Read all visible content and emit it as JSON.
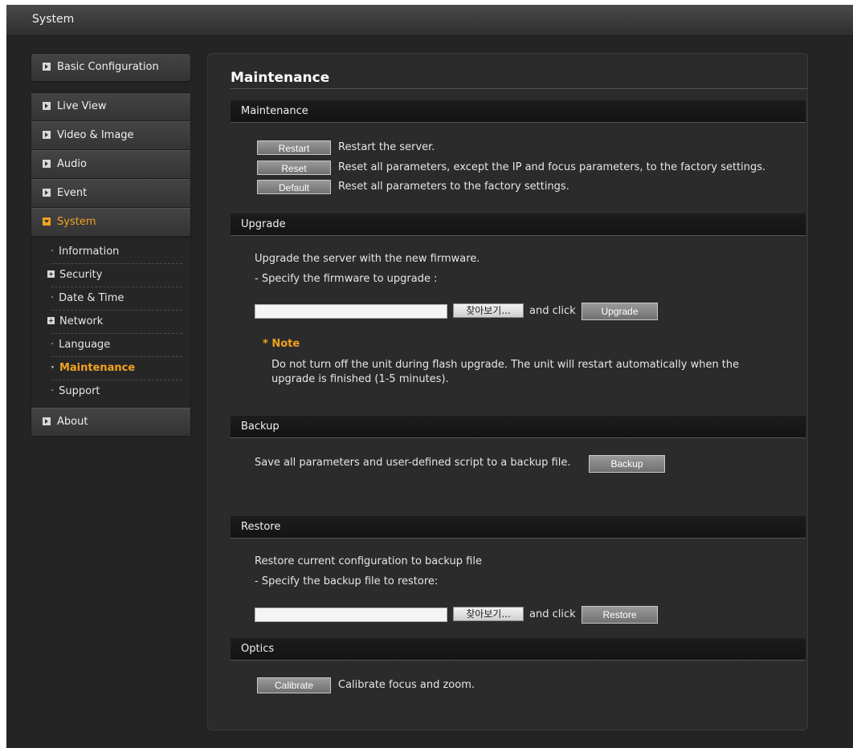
{
  "window": {
    "title": "System"
  },
  "sidebar": {
    "top_item": "Basic Configuration",
    "items": [
      "Live View",
      "Video & Image",
      "Audio",
      "Event",
      "System"
    ],
    "active": "System",
    "system_sub": [
      {
        "label": "Information",
        "kind": "dot"
      },
      {
        "label": "Security",
        "kind": "plus"
      },
      {
        "label": "Date & Time",
        "kind": "dot"
      },
      {
        "label": "Network",
        "kind": "plus"
      },
      {
        "label": "Language",
        "kind": "dot"
      },
      {
        "label": "Maintenance",
        "kind": "dot",
        "current": true
      },
      {
        "label": "Support",
        "kind": "dot"
      }
    ],
    "bottom_item": "About"
  },
  "main": {
    "title": "Maintenance",
    "sections": {
      "maintenance": {
        "header": "Maintenance",
        "rows": [
          {
            "button": "Restart",
            "text": "Restart the server."
          },
          {
            "button": "Reset",
            "text": "Reset all parameters, except the IP and focus parameters, to the factory settings."
          },
          {
            "button": "Default",
            "text": "Reset all parameters to the factory settings."
          }
        ]
      },
      "upgrade": {
        "header": "Upgrade",
        "line1": "Upgrade the server with the new firmware.",
        "line2": "- Specify the firmware to upgrade :",
        "browse_label": "찾아보기...",
        "and_click": "and click",
        "button": "Upgrade",
        "note_title": "* Note",
        "note_body": "Do not turn off the unit during flash upgrade. The unit will restart automatically when the upgrade is finished (1-5 minutes)."
      },
      "backup": {
        "header": "Backup",
        "text": "Save all parameters and user-defined script to a backup file.",
        "button": "Backup"
      },
      "restore": {
        "header": "Restore",
        "line1": "Restore current configuration to backup file",
        "line2": "- Specify the backup file to restore:",
        "browse_label": "찾아보기...",
        "and_click": "and click",
        "button": "Restore"
      },
      "optics": {
        "header": "Optics",
        "button": "Calibrate",
        "text": "Calibrate focus and zoom."
      }
    }
  },
  "colors": {
    "accent": "#f3a21f",
    "background": "#242424",
    "panel": "#2b2b2b"
  }
}
